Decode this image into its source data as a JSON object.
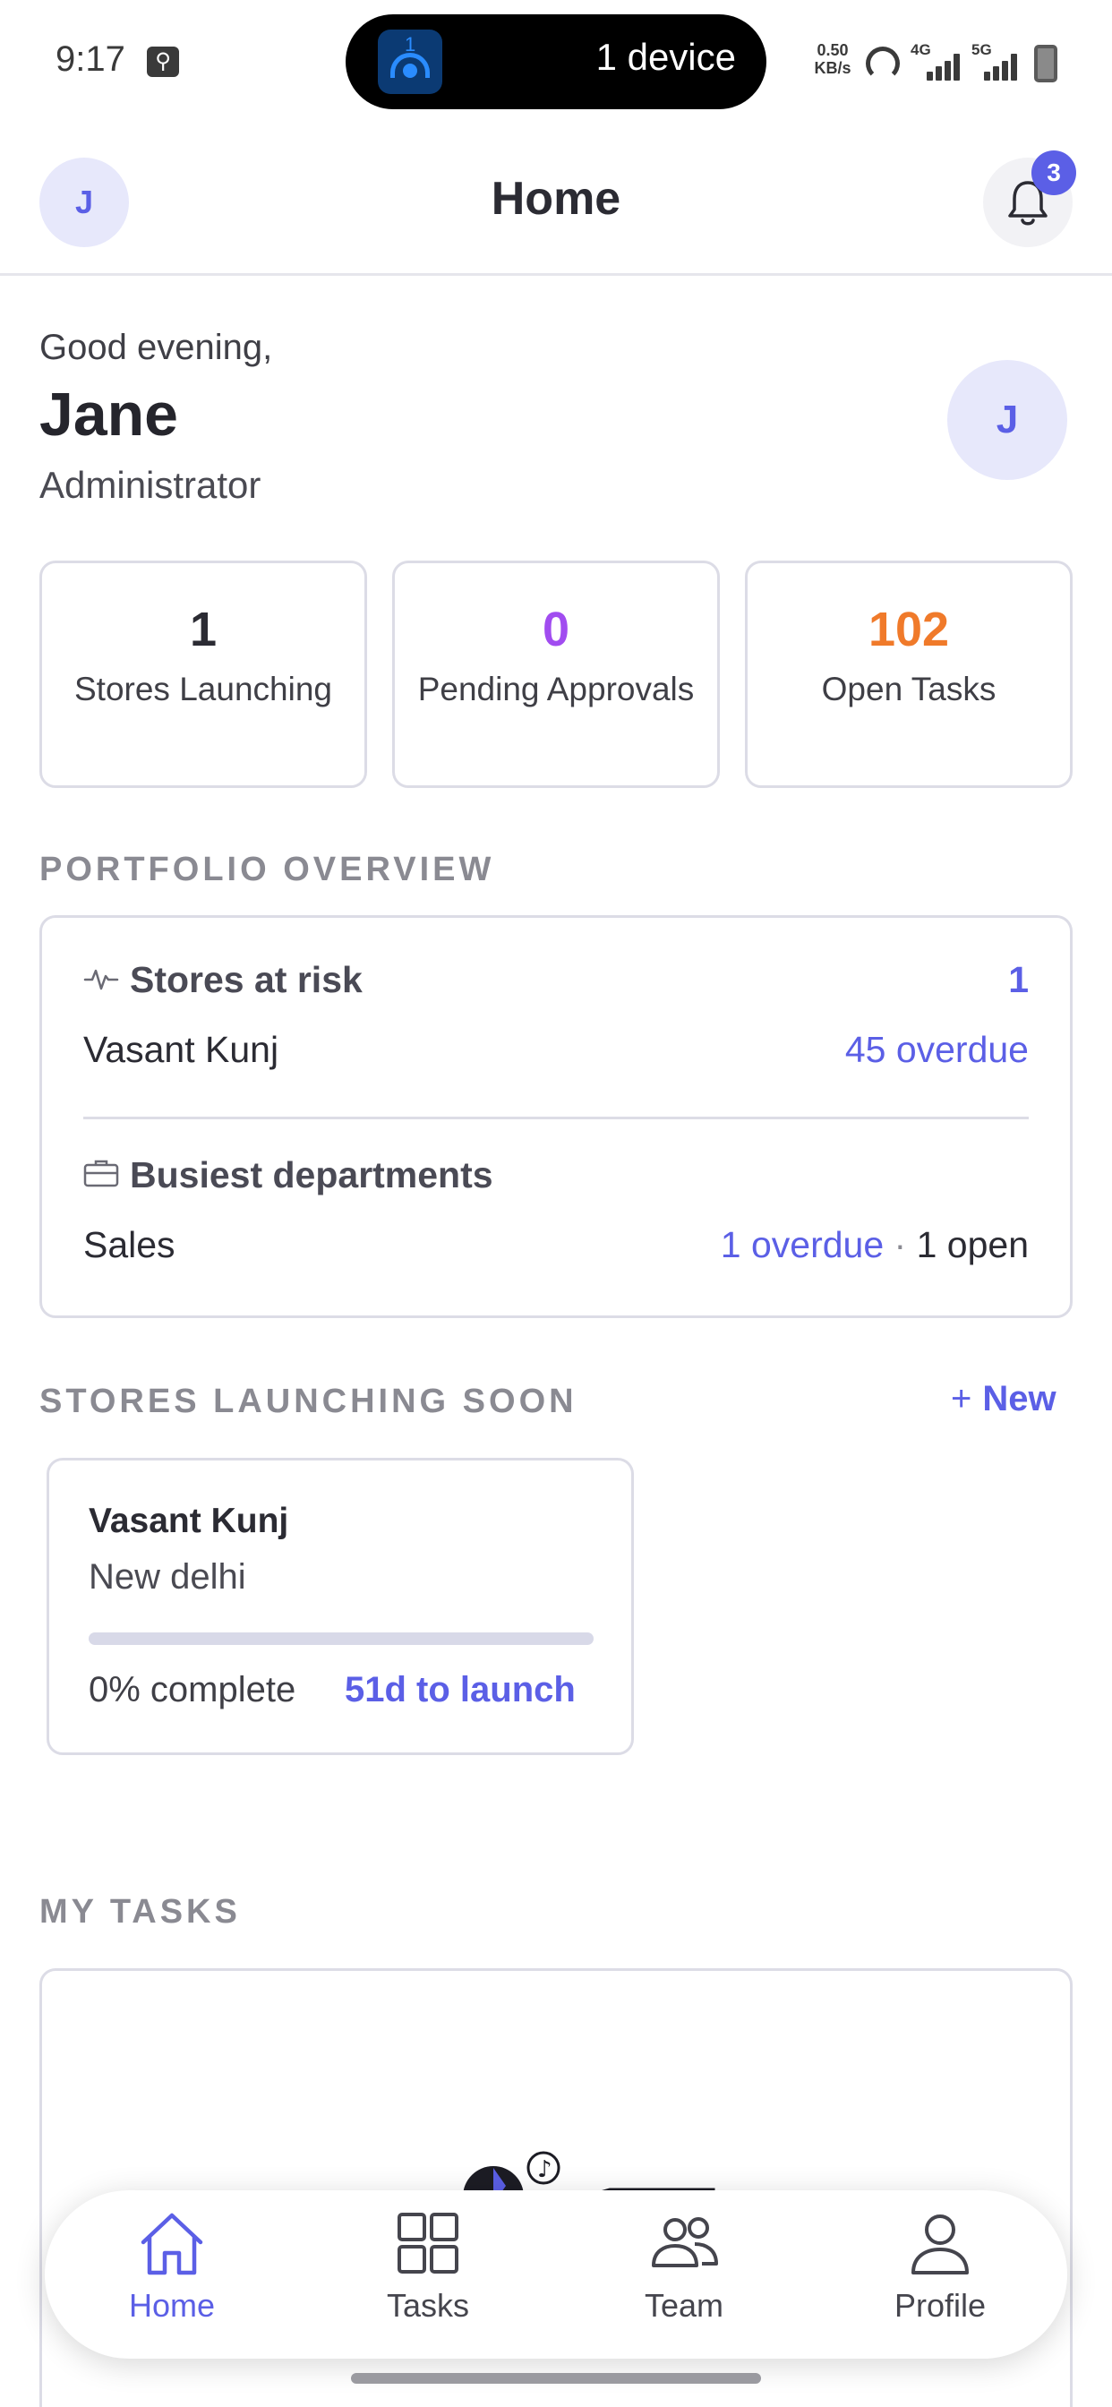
{
  "status_bar": {
    "time": "9:17",
    "island_app_badge": "1",
    "island_text": "1 device",
    "net_speed_value": "0.50",
    "net_speed_unit": "KB/s",
    "signal1_label": "4G",
    "signal2_label": "5G"
  },
  "header": {
    "avatar_initial": "J",
    "title": "Home",
    "notification_count": "3"
  },
  "greeting": {
    "salutation": "Good evening,",
    "name": "Jane",
    "role": "Administrator",
    "avatar_initial": "J"
  },
  "stats": [
    {
      "value": "1",
      "label": "Stores Launching",
      "color": "#2b2b33"
    },
    {
      "value": "0",
      "label": "Pending Approvals",
      "color": "#a14cf0"
    },
    {
      "value": "102",
      "label": "Open Tasks",
      "color": "#f07a2a"
    }
  ],
  "portfolio": {
    "section_title": "PORTFOLIO OVERVIEW",
    "at_risk": {
      "heading": "Stores at risk",
      "count": "1",
      "store": "Vasant Kunj",
      "overdue": "45 overdue"
    },
    "busiest": {
      "heading": "Busiest departments",
      "department": "Sales",
      "overdue": "1 overdue",
      "separator": " · ",
      "open": "1 open"
    }
  },
  "launching": {
    "section_title": "STORES LAUNCHING SOON",
    "new_label": "New",
    "store": {
      "name": "Vasant Kunj",
      "city": "New delhi",
      "progress_percent": 0,
      "complete_text": "0% complete",
      "launch_text": "51d to launch"
    }
  },
  "my_tasks": {
    "section_title": "MY TASKS"
  },
  "nav": {
    "home": "Home",
    "tasks": "Tasks",
    "team": "Team",
    "profile": "Profile"
  },
  "colors": {
    "accent": "#5b5fe6",
    "purple": "#a14cf0",
    "orange": "#f07a2a",
    "border": "#dcdce6"
  }
}
